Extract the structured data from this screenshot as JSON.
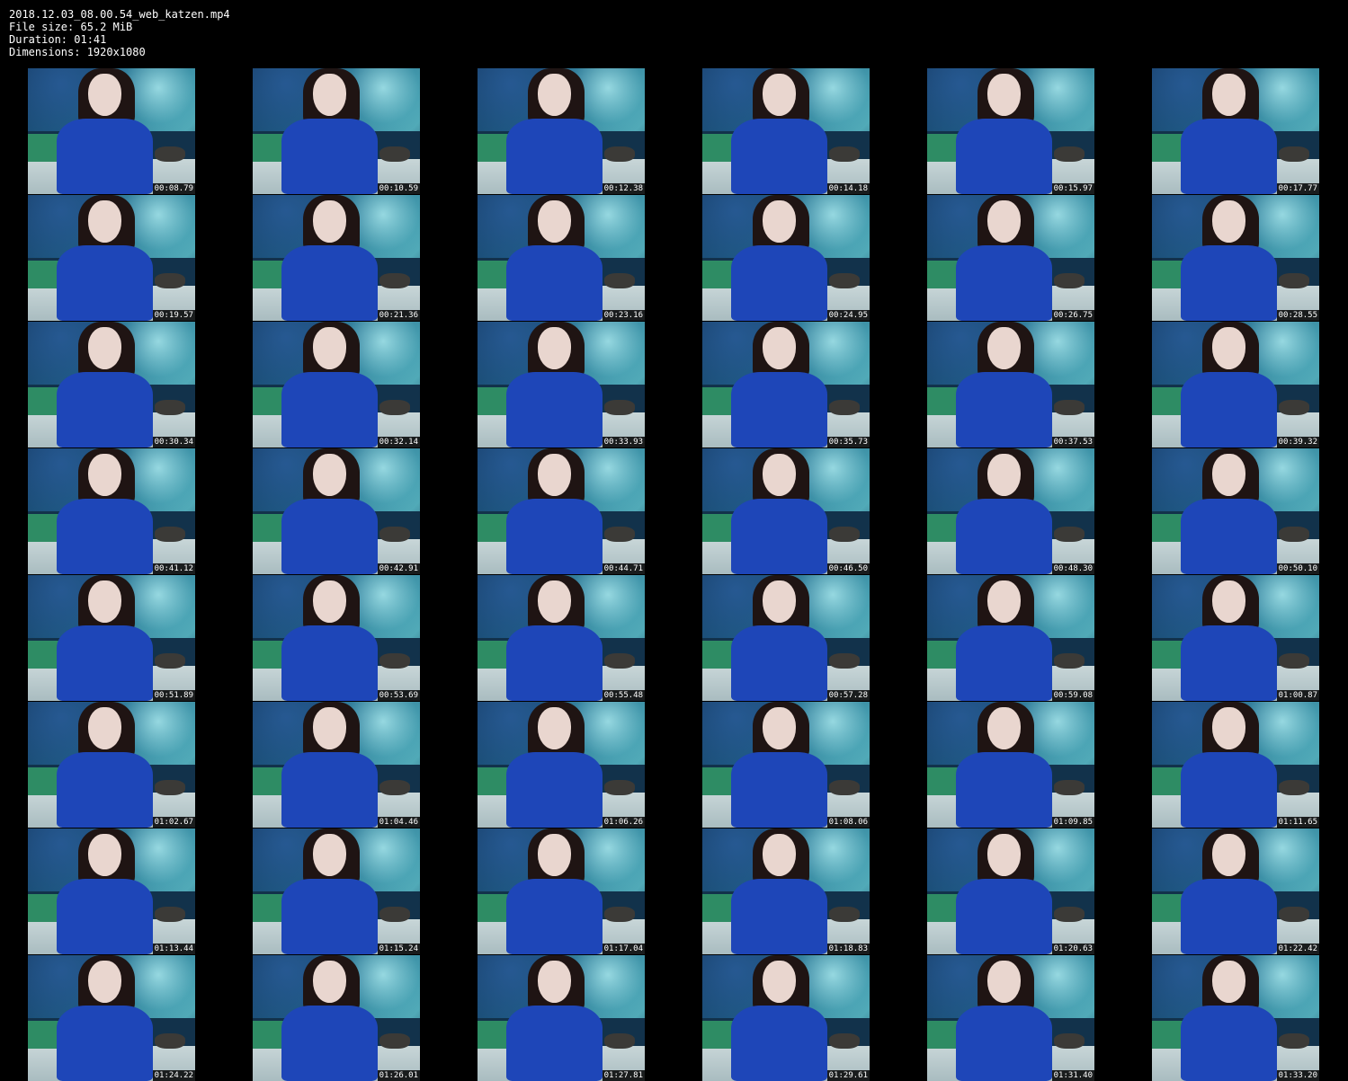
{
  "header": {
    "filename": "2018.12.03_08.00.54_web_katzen.mp4",
    "file_size": "File size: 65.2 MiB",
    "duration": "Duration: 01:41",
    "dimensions": "Dimensions: 1920x1080"
  },
  "thumbnails": [
    "00:08.79",
    "00:10.59",
    "00:12.38",
    "00:14.18",
    "00:15.97",
    "00:17.77",
    "00:19.57",
    "00:21.36",
    "00:23.16",
    "00:24.95",
    "00:26.75",
    "00:28.55",
    "00:30.34",
    "00:32.14",
    "00:33.93",
    "00:35.73",
    "00:37.53",
    "00:39.32",
    "00:41.12",
    "00:42.91",
    "00:44.71",
    "00:46.50",
    "00:48.30",
    "00:50.10",
    "00:51.89",
    "00:53.69",
    "00:55.48",
    "00:57.28",
    "00:59.08",
    "01:00.87",
    "01:02.67",
    "01:04.46",
    "01:06.26",
    "01:08.06",
    "01:09.85",
    "01:11.65",
    "01:13.44",
    "01:15.24",
    "01:17.04",
    "01:18.83",
    "01:20.63",
    "01:22.42",
    "01:24.22",
    "01:26.01",
    "01:27.81",
    "01:29.61",
    "01:31.40",
    "01:33.20"
  ]
}
